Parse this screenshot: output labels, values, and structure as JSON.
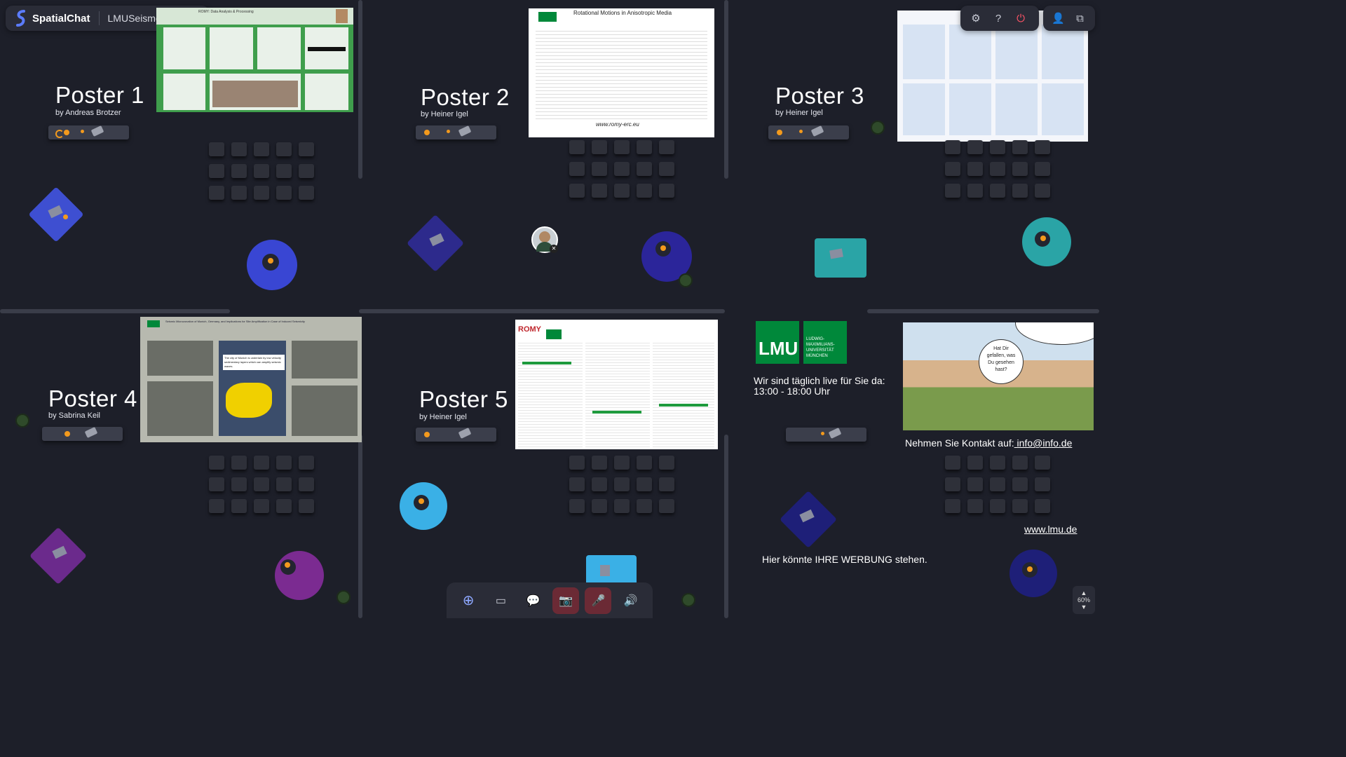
{
  "app": {
    "brand": "SpatialChat",
    "space": "LMUSeismology",
    "user_count": "1"
  },
  "posters": [
    {
      "title": "Poster 1",
      "author": "by Andreas Brotzer"
    },
    {
      "title": "Poster 2",
      "author": "by Heiner Igel"
    },
    {
      "title": "Poster 3",
      "author": "by Heiner Igel"
    },
    {
      "title": "Poster 4",
      "author": "by Sabrina Keil"
    },
    {
      "title": "Poster 5",
      "author": "by Heiner Igel"
    }
  ],
  "poster_images": {
    "p1_title": "ROMY: Data Analysis & Processing",
    "p2_title": "Rotational Motions in Anisotropic Media",
    "p2_footer": "www.romy-erc.eu",
    "p4_title": "Seismic Microzonation of Munich, Germany, and Implications for Site Amplification in Case of Induced Seismicity",
    "p4_caption": "The city of Munich is underlain by low velocity sedimentary layers which can amplify seismic waves.",
    "p5_brand": "ROMY"
  },
  "lmu": {
    "logo_text": "LMU",
    "logo_name": "LUDWIG-MAXIMILIANS-UNIVERSITÄT MÜNCHEN",
    "live_line1": "Wir sind täglich live für Sie da:",
    "live_line2": "13:00 - 18:00 Uhr",
    "contact_prefix": "Nehmen Sie Kontakt auf:",
    "contact_email": " info@info.de",
    "speech_bubble": "Hat Dir gefallen, was Du gesehen hast?",
    "website": "www.lmu.de",
    "ad_text": "Hier könnte IHRE WERBUNG stehen."
  },
  "zoom": "60%",
  "colors": {
    "background": "#1d1f29",
    "accent": "#f39a1d",
    "lmu_green": "#00883a",
    "danger": "#6b2a35"
  }
}
